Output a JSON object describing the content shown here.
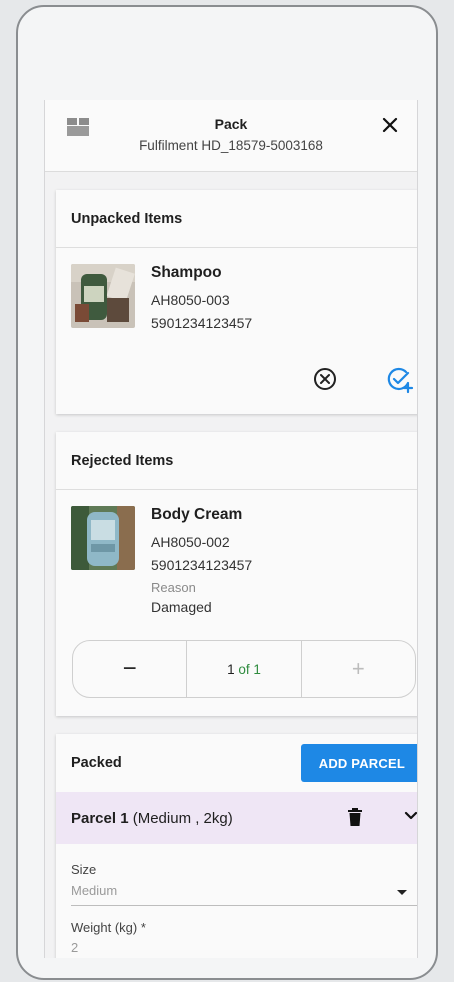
{
  "header": {
    "title": "Pack",
    "subtitle": "Fulfilment HD_18579-5003168",
    "close_icon": "close-icon"
  },
  "unpacked": {
    "heading": "Unpacked Items",
    "item": {
      "name": "Shampoo",
      "sku": "AH8050-003",
      "barcode": "5901234123457"
    },
    "reject_icon": "circle-x-icon",
    "pack_icon": "check-plus-icon"
  },
  "rejected": {
    "heading": "Rejected Items",
    "item": {
      "name": "Body Cream",
      "sku": "AH8050-002",
      "barcode": "5901234123457",
      "reason_label": "Reason",
      "reason": "Damaged"
    },
    "stepper": {
      "minus": "−",
      "count_current": "1",
      "count_sep": "of",
      "count_total": "1",
      "plus": "+"
    }
  },
  "packed": {
    "heading": "Packed",
    "add_button": "ADD PARCEL",
    "parcel": {
      "name": "Parcel 1",
      "details": " (Medium , 2kg)"
    },
    "form": {
      "size_label": "Size",
      "size_value": "Medium",
      "weight_label": "Weight (kg) *",
      "weight_value": "2"
    }
  },
  "colors": {
    "accent": "#1e88e5",
    "parcel_bg": "#efe6f5",
    "count_green": "#2e8b3e"
  }
}
